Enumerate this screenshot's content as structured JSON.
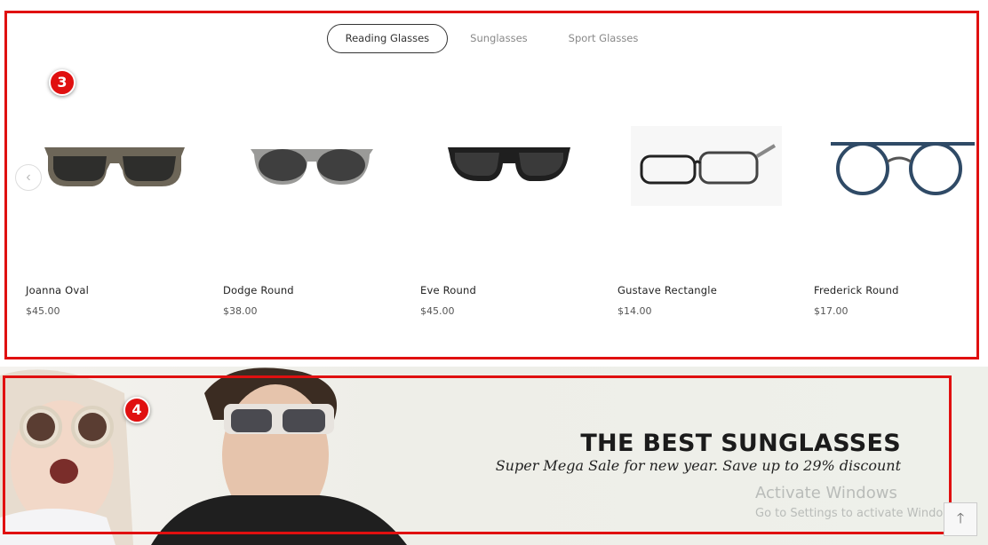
{
  "tabs": [
    {
      "label": "Reading Glasses",
      "active": true
    },
    {
      "label": "Sunglasses",
      "active": false
    },
    {
      "label": "Sport Glasses",
      "active": false
    }
  ],
  "badges": {
    "products": "3",
    "banner": "4"
  },
  "carousel": {
    "prev_icon": "chevron-left-icon"
  },
  "products": [
    {
      "name": "Joanna Oval",
      "price": "$45.00"
    },
    {
      "name": "Dodge Round",
      "price": "$38.00"
    },
    {
      "name": "Eve Round",
      "price": "$45.00"
    },
    {
      "name": "Gustave Rectangle",
      "price": "$14.00"
    },
    {
      "name": "Frederick Round",
      "price": "$17.00"
    }
  ],
  "banner": {
    "title": "THE BEST SUNGLASSES",
    "subtitle": "Super Mega Sale for new year. Save up to 29% discount"
  },
  "watermark": {
    "line1": "Activate Windows",
    "line2": "Go to Settings to activate Windows."
  },
  "colors": {
    "highlight": "#e01010",
    "text": "#222222",
    "muted": "#888888"
  }
}
